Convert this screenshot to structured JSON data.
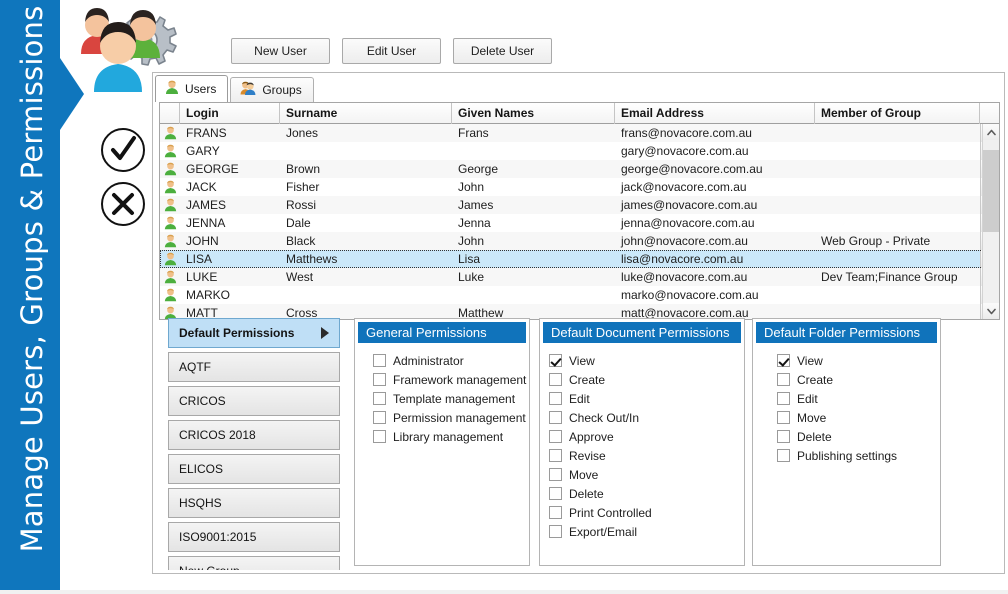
{
  "banner": {
    "title": "Manage Users, Groups & Permissions",
    "color": "#0f76bd"
  },
  "hero": {
    "users_gear_icon": "users-gear-icon",
    "tick_icon": "tick-circle-icon",
    "cross_icon": "cross-circle-icon"
  },
  "toolbar": {
    "new_user": "New User",
    "edit_user": "Edit User",
    "delete_user": "Delete User"
  },
  "tabs": [
    {
      "label": "Users",
      "icon": "single-user-icon",
      "active": true
    },
    {
      "label": "Groups",
      "icon": "multiple-users-icon",
      "active": false
    }
  ],
  "grid": {
    "columns": [
      "",
      "Login",
      "Surname",
      "Given Names",
      "Email Address",
      "Member of Group"
    ],
    "rows": [
      {
        "icon": "user-icon",
        "login": "FRANS",
        "surname": "Jones",
        "given": "Frans",
        "email": "frans@novacore.com.au",
        "group": "",
        "selected": false
      },
      {
        "icon": "user-icon",
        "login": "GARY",
        "surname": "",
        "given": "",
        "email": "gary@novacore.com.au",
        "group": "",
        "selected": false
      },
      {
        "icon": "user-icon",
        "login": "GEORGE",
        "surname": "Brown",
        "given": "George",
        "email": "george@novacore.com.au",
        "group": "",
        "selected": false
      },
      {
        "icon": "user-icon",
        "login": "JACK",
        "surname": "Fisher",
        "given": "John",
        "email": "jack@novacore.com.au",
        "group": "",
        "selected": false
      },
      {
        "icon": "user-icon",
        "login": "JAMES",
        "surname": "Rossi",
        "given": "James",
        "email": "james@novacore.com.au",
        "group": "",
        "selected": false
      },
      {
        "icon": "user-icon",
        "login": "JENNA",
        "surname": "Dale",
        "given": "Jenna",
        "email": "jenna@novacore.com.au",
        "group": "",
        "selected": false
      },
      {
        "icon": "user-icon",
        "login": "JOHN",
        "surname": "Black",
        "given": "John",
        "email": "john@novacore.com.au",
        "group": "Web Group - Private",
        "selected": false
      },
      {
        "icon": "user-icon",
        "login": "LISA",
        "surname": "Matthews",
        "given": "Lisa",
        "email": "lisa@novacore.com.au",
        "group": "",
        "selected": true
      },
      {
        "icon": "user-icon",
        "login": "LUKE",
        "surname": "West",
        "given": "Luke",
        "email": "luke@novacore.com.au",
        "group": "Dev Team;Finance Group",
        "selected": false
      },
      {
        "icon": "user-icon",
        "login": "MARKO",
        "surname": "",
        "given": "",
        "email": "marko@novacore.com.au",
        "group": "",
        "selected": false
      },
      {
        "icon": "user-icon",
        "login": "MATT",
        "surname": "Cross",
        "given": "Matthew",
        "email": "matt@novacore.com.au",
        "group": "",
        "selected": false
      }
    ],
    "row_dropdown_icon": "chevron-down-icon",
    "scroll_up_icon": "chevron-up-icon",
    "scroll_down_icon": "chevron-down-icon"
  },
  "groups": {
    "items": [
      {
        "label": "Default Permissions",
        "active": true,
        "arrow": "chevron-right-icon"
      },
      {
        "label": "AQTF",
        "active": false
      },
      {
        "label": "CRICOS",
        "active": false
      },
      {
        "label": "CRICOS 2018",
        "active": false
      },
      {
        "label": "ELICOS",
        "active": false
      },
      {
        "label": "HSQHS",
        "active": false
      },
      {
        "label": "ISO9001:2015",
        "active": false
      },
      {
        "label": "New Group",
        "active": false
      }
    ]
  },
  "permissions": {
    "header_color": "#1073bb",
    "general": {
      "title": "General Permissions",
      "items": [
        {
          "label": "Administrator",
          "checked": false
        },
        {
          "label": "Framework management",
          "checked": false
        },
        {
          "label": "Template management",
          "checked": false
        },
        {
          "label": "Permission management",
          "checked": false
        },
        {
          "label": "Library management",
          "checked": false
        }
      ]
    },
    "document": {
      "title": "Default Document Permissions",
      "items": [
        {
          "label": "View",
          "checked": true
        },
        {
          "label": "Create",
          "checked": false
        },
        {
          "label": "Edit",
          "checked": false
        },
        {
          "label": "Check Out/In",
          "checked": false
        },
        {
          "label": "Approve",
          "checked": false
        },
        {
          "label": "Revise",
          "checked": false
        },
        {
          "label": "Move",
          "checked": false
        },
        {
          "label": "Delete",
          "checked": false
        },
        {
          "label": "Print Controlled",
          "checked": false
        },
        {
          "label": "Export/Email",
          "checked": false
        }
      ]
    },
    "folder": {
      "title": "Default Folder Permissions",
      "items": [
        {
          "label": "View",
          "checked": true
        },
        {
          "label": "Create",
          "checked": false
        },
        {
          "label": "Edit",
          "checked": false
        },
        {
          "label": "Move",
          "checked": false
        },
        {
          "label": "Delete",
          "checked": false
        },
        {
          "label": "Publishing settings",
          "checked": false
        }
      ]
    }
  }
}
